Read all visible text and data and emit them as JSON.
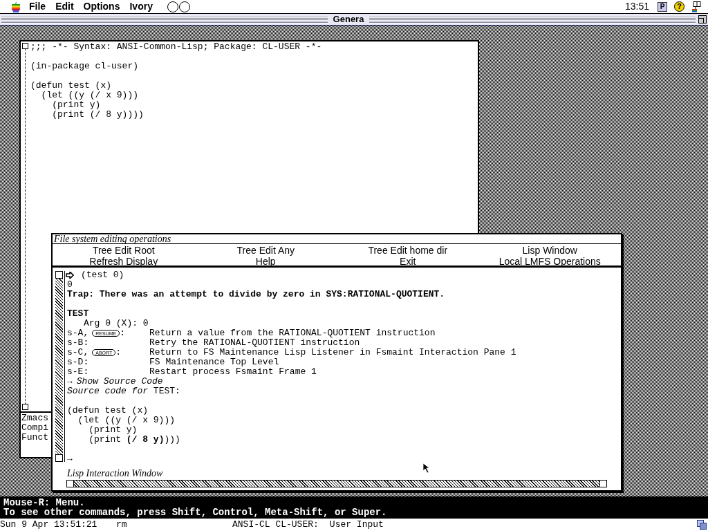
{
  "menu_bar": {
    "menus": [
      "File",
      "Edit",
      "Options",
      "Ivory"
    ],
    "clock": "13:51",
    "app_menu": "P",
    "help": "?"
  },
  "window": {
    "title": "Genera"
  },
  "editor": {
    "lines": [
      {
        "kind": "code",
        "text": ";;; -*- Syntax: ANSI-Common-Lisp; Package: CL-USER -*-"
      },
      {
        "kind": "blank"
      },
      {
        "kind": "code",
        "text": "(in-package cl-user)"
      },
      {
        "kind": "blank"
      },
      {
        "kind": "code",
        "text": "(defun test (x)"
      },
      {
        "kind": "code",
        "text": "  (let ((y (/ x 9)))"
      },
      {
        "kind": "code",
        "text": "    (print y)"
      },
      {
        "kind": "code",
        "text": "    (print (/ 8 y))))"
      }
    ],
    "mode_line": [
      "Zmacs",
      "Compi",
      "Funct"
    ]
  },
  "frame": {
    "menu_title": "File system editing operations",
    "commands": [
      "Tree Edit Root",
      "Tree Edit Any",
      "Tree Edit home dir",
      "Lisp Window",
      "Refresh Display",
      "Help",
      "Exit",
      "Local LMFS Operations"
    ],
    "lines": [
      {
        "kind": "command",
        "text": "(test 0)"
      },
      {
        "kind": "plain",
        "text": "0"
      },
      {
        "kind": "bold",
        "text": "Trap: There was an attempt to divide by zero in SYS:RATIONAL-QUOTIENT."
      },
      {
        "kind": "blank"
      },
      {
        "kind": "bold",
        "text": "TEST"
      },
      {
        "kind": "arg",
        "text": "Arg 0 (X): 0"
      },
      {
        "kind": "restart",
        "key": "s-A,",
        "badge": "RESUME",
        "suffix": ":",
        "text": "Return a value from the RATIONAL-QUOTIENT instruction"
      },
      {
        "kind": "restart",
        "key": "s-B:",
        "text": "Retry the RATIONAL-QUOTIENT instruction"
      },
      {
        "kind": "restart",
        "key": "s-C,",
        "badge": "ABORT",
        "suffix": ":",
        "text": "Return to FS Maintenance Lisp Listener in Fsmaint Interaction Pane 1"
      },
      {
        "kind": "restart",
        "key": "s-D:",
        "text": "FS Maintenance Top Level"
      },
      {
        "kind": "restart",
        "key": "s-E:",
        "text": "Restart process Fsmaint Frame 1"
      },
      {
        "kind": "link",
        "arrow": "→",
        "text": "Show Source Code"
      },
      {
        "kind": "plain",
        "text": "*Source code for* TEST:"
      },
      {
        "kind": "blank"
      },
      {
        "kind": "plain",
        "text": "(defun test (x)"
      },
      {
        "kind": "plain",
        "text": "  (let ((y (/ x 9)))"
      },
      {
        "kind": "plain",
        "text": "    (print y)"
      },
      {
        "kind": "plain",
        "text": "    (print **(/ 8 y)**)))"
      },
      {
        "kind": "blank"
      },
      {
        "kind": "prompt",
        "text": "→"
      }
    ],
    "pane_label": "Lisp Interaction Window"
  },
  "mouse_doc": [
    "Mouse-R: Menu.",
    "To see other commands, press Shift, Control, Meta-Shift, or Super."
  ],
  "status_bar": {
    "date": "Sun 9 Apr 13:51:21",
    "user": "rm",
    "package": "ANSI-CL CL-USER:",
    "state": "User Input"
  }
}
